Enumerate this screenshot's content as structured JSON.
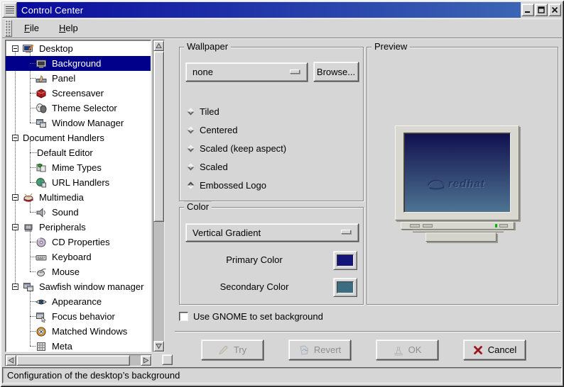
{
  "window": {
    "title": "Control Center",
    "controls": {
      "minimize": "minimize",
      "maximize": "maximize",
      "close": "close"
    }
  },
  "menu": {
    "items": [
      {
        "label": "File"
      },
      {
        "label": "Help"
      }
    ]
  },
  "tree": {
    "items": [
      {
        "label": "Desktop",
        "type": "group",
        "icon": "desktop-icon",
        "selected": false
      },
      {
        "label": "Background",
        "type": "child",
        "icon": "background-icon",
        "selected": true
      },
      {
        "label": "Panel",
        "type": "child",
        "icon": "panel-icon",
        "selected": false
      },
      {
        "label": "Screensaver",
        "type": "child",
        "icon": "screensaver-icon",
        "selected": false
      },
      {
        "label": "Theme Selector",
        "type": "child",
        "icon": "theme-icon",
        "selected": false
      },
      {
        "label": "Window Manager",
        "type": "child",
        "icon": "window-manager-icon",
        "selected": false
      },
      {
        "label": "Document Handlers",
        "type": "group",
        "icon": "",
        "selected": false
      },
      {
        "label": "Default Editor",
        "type": "child",
        "icon": "",
        "selected": false
      },
      {
        "label": "Mime Types",
        "type": "child",
        "icon": "mime-icon",
        "selected": false
      },
      {
        "label": "URL Handlers",
        "type": "child",
        "icon": "url-icon",
        "selected": false
      },
      {
        "label": "Multimedia",
        "type": "group",
        "icon": "multimedia-icon",
        "selected": false
      },
      {
        "label": "Sound",
        "type": "child",
        "icon": "sound-icon",
        "selected": false
      },
      {
        "label": "Peripherals",
        "type": "group",
        "icon": "peripherals-icon",
        "selected": false
      },
      {
        "label": "CD Properties",
        "type": "child",
        "icon": "cd-icon",
        "selected": false
      },
      {
        "label": "Keyboard",
        "type": "child",
        "icon": "keyboard-icon",
        "selected": false
      },
      {
        "label": "Mouse",
        "type": "child",
        "icon": "mouse-icon",
        "selected": false
      },
      {
        "label": "Sawfish window manager",
        "type": "group",
        "icon": "sawfish-icon",
        "selected": false
      },
      {
        "label": "Appearance",
        "type": "child",
        "icon": "appearance-icon",
        "selected": false
      },
      {
        "label": "Focus behavior",
        "type": "child",
        "icon": "focus-icon",
        "selected": false
      },
      {
        "label": "Matched Windows",
        "type": "child",
        "icon": "matched-icon",
        "selected": false
      },
      {
        "label": "Meta",
        "type": "child",
        "icon": "meta-icon",
        "selected": false
      }
    ]
  },
  "wallpaper": {
    "legend": "Wallpaper",
    "file_select": {
      "value": "none"
    },
    "browse_label": "Browse...",
    "modes": [
      {
        "label": "Tiled",
        "selected": false
      },
      {
        "label": "Centered",
        "selected": false
      },
      {
        "label": "Scaled (keep aspect)",
        "selected": false
      },
      {
        "label": "Scaled",
        "selected": false
      },
      {
        "label": "Embossed Logo",
        "selected": true
      }
    ]
  },
  "color": {
    "legend": "Color",
    "gradient_select": {
      "value": "Vertical Gradient"
    },
    "primary": {
      "label": "Primary Color",
      "color": "#14147a"
    },
    "secondary": {
      "label": "Secondary Color",
      "color": "#41748c"
    }
  },
  "preview": {
    "legend": "Preview",
    "logo_text": "redhat"
  },
  "options": {
    "use_gnome_label": "Use GNOME to set background",
    "checked": false
  },
  "actions": {
    "try": {
      "label": "Try",
      "icon": "try-icon",
      "disabled": true
    },
    "revert": {
      "label": "Revert",
      "icon": "revert-icon",
      "disabled": true
    },
    "ok": {
      "label": "OK",
      "icon": "ok-icon",
      "disabled": true
    },
    "cancel": {
      "label": "Cancel",
      "icon": "cancel-icon",
      "disabled": false
    }
  },
  "statusbar": {
    "text": "Configuration of the desktop’s background"
  },
  "colors": {
    "titlebar_start": "#0a0a9e",
    "titlebar_end": "#3c66b4",
    "selection": "#00008a",
    "screen_top": "#10104e",
    "screen_bottom": "#4e7492"
  }
}
